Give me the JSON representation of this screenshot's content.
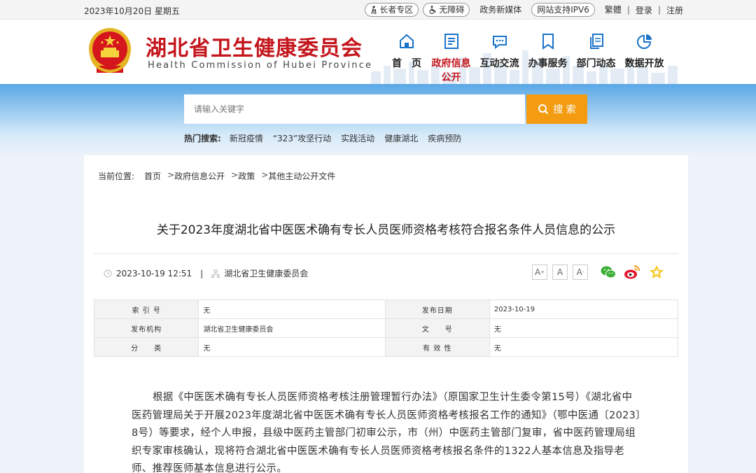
{
  "topbar": {
    "date": "2023年10月20日 星期五",
    "elder": "长者专区",
    "accessible": "无障碍",
    "media": "政务新媒体",
    "ipv6": "网站支持IPV6",
    "traditional": "繁體",
    "login": "登录",
    "register": "注册"
  },
  "header": {
    "title": "湖北省卫生健康委员会",
    "subtitle": "Health Commission of Hubei Province"
  },
  "nav": [
    {
      "label": "首　页",
      "icon": "home-icon"
    },
    {
      "label": "政府信息公开",
      "icon": "document-icon"
    },
    {
      "label": "互动交流",
      "icon": "chat-icon"
    },
    {
      "label": "办事服务",
      "icon": "bookmark-icon"
    },
    {
      "label": "部门动态",
      "icon": "copy-icon"
    },
    {
      "label": "数据开放",
      "icon": "pie-chart-icon"
    }
  ],
  "search": {
    "placeholder": "请输入关键字",
    "button": "搜 索",
    "hot_label": "热门搜索:",
    "hot": [
      "新冠疫情",
      "“323”攻坚行动",
      "实践活动",
      "健康湖北",
      "疾病预防"
    ]
  },
  "breadcrumb": {
    "label": "当前位置:",
    "items": [
      "首页",
      "政府信息公开",
      "政策",
      "其他主动公开文件"
    ]
  },
  "article": {
    "title": "关于2023年度湖北省中医医术确有专长人员医师资格考核符合报名条件人员信息的公示",
    "datetime": "2023-10-19 12:51",
    "source": "湖北省卫生健康委员会",
    "font_large": "A",
    "font_medium": "A",
    "font_small": "A"
  },
  "info_table": {
    "rows": [
      [
        {
          "k": "索 引 号",
          "v": "无"
        },
        {
          "k": "发布日期",
          "v": "2023-10-19"
        }
      ],
      [
        {
          "k": "发布机构",
          "v": "湖北省卫生健康委员会"
        },
        {
          "k": "文　　号",
          "v": "无"
        }
      ],
      [
        {
          "k": "分　　类",
          "v": "无"
        },
        {
          "k": "有 效 性",
          "v": "无"
        }
      ]
    ]
  },
  "body": {
    "paragraph": "根据《中医医术确有专长人员医师资格考核注册管理暂行办法》（原国家卫生计生委令第15号）《湖北省中医药管理局关于开展2023年度湖北省中医医术确有专长人员医师资格考核报名工作的通知》（鄂中医通〔2023〕8号）等要求，经个人申报，县级中医药主管部门初审公示，市（州）中医药主管部门复审，省中医药管理局组织专家审核确认，现将符合湖北省中医医术确有专长人员医师资格考核报名条件的1322人基本信息及指导老师、推荐医师基本信息进行公示。"
  },
  "colors": {
    "brand_red": "#c4151c",
    "search_orange": "#f39c12",
    "band_blue": "#5aa8e6"
  }
}
